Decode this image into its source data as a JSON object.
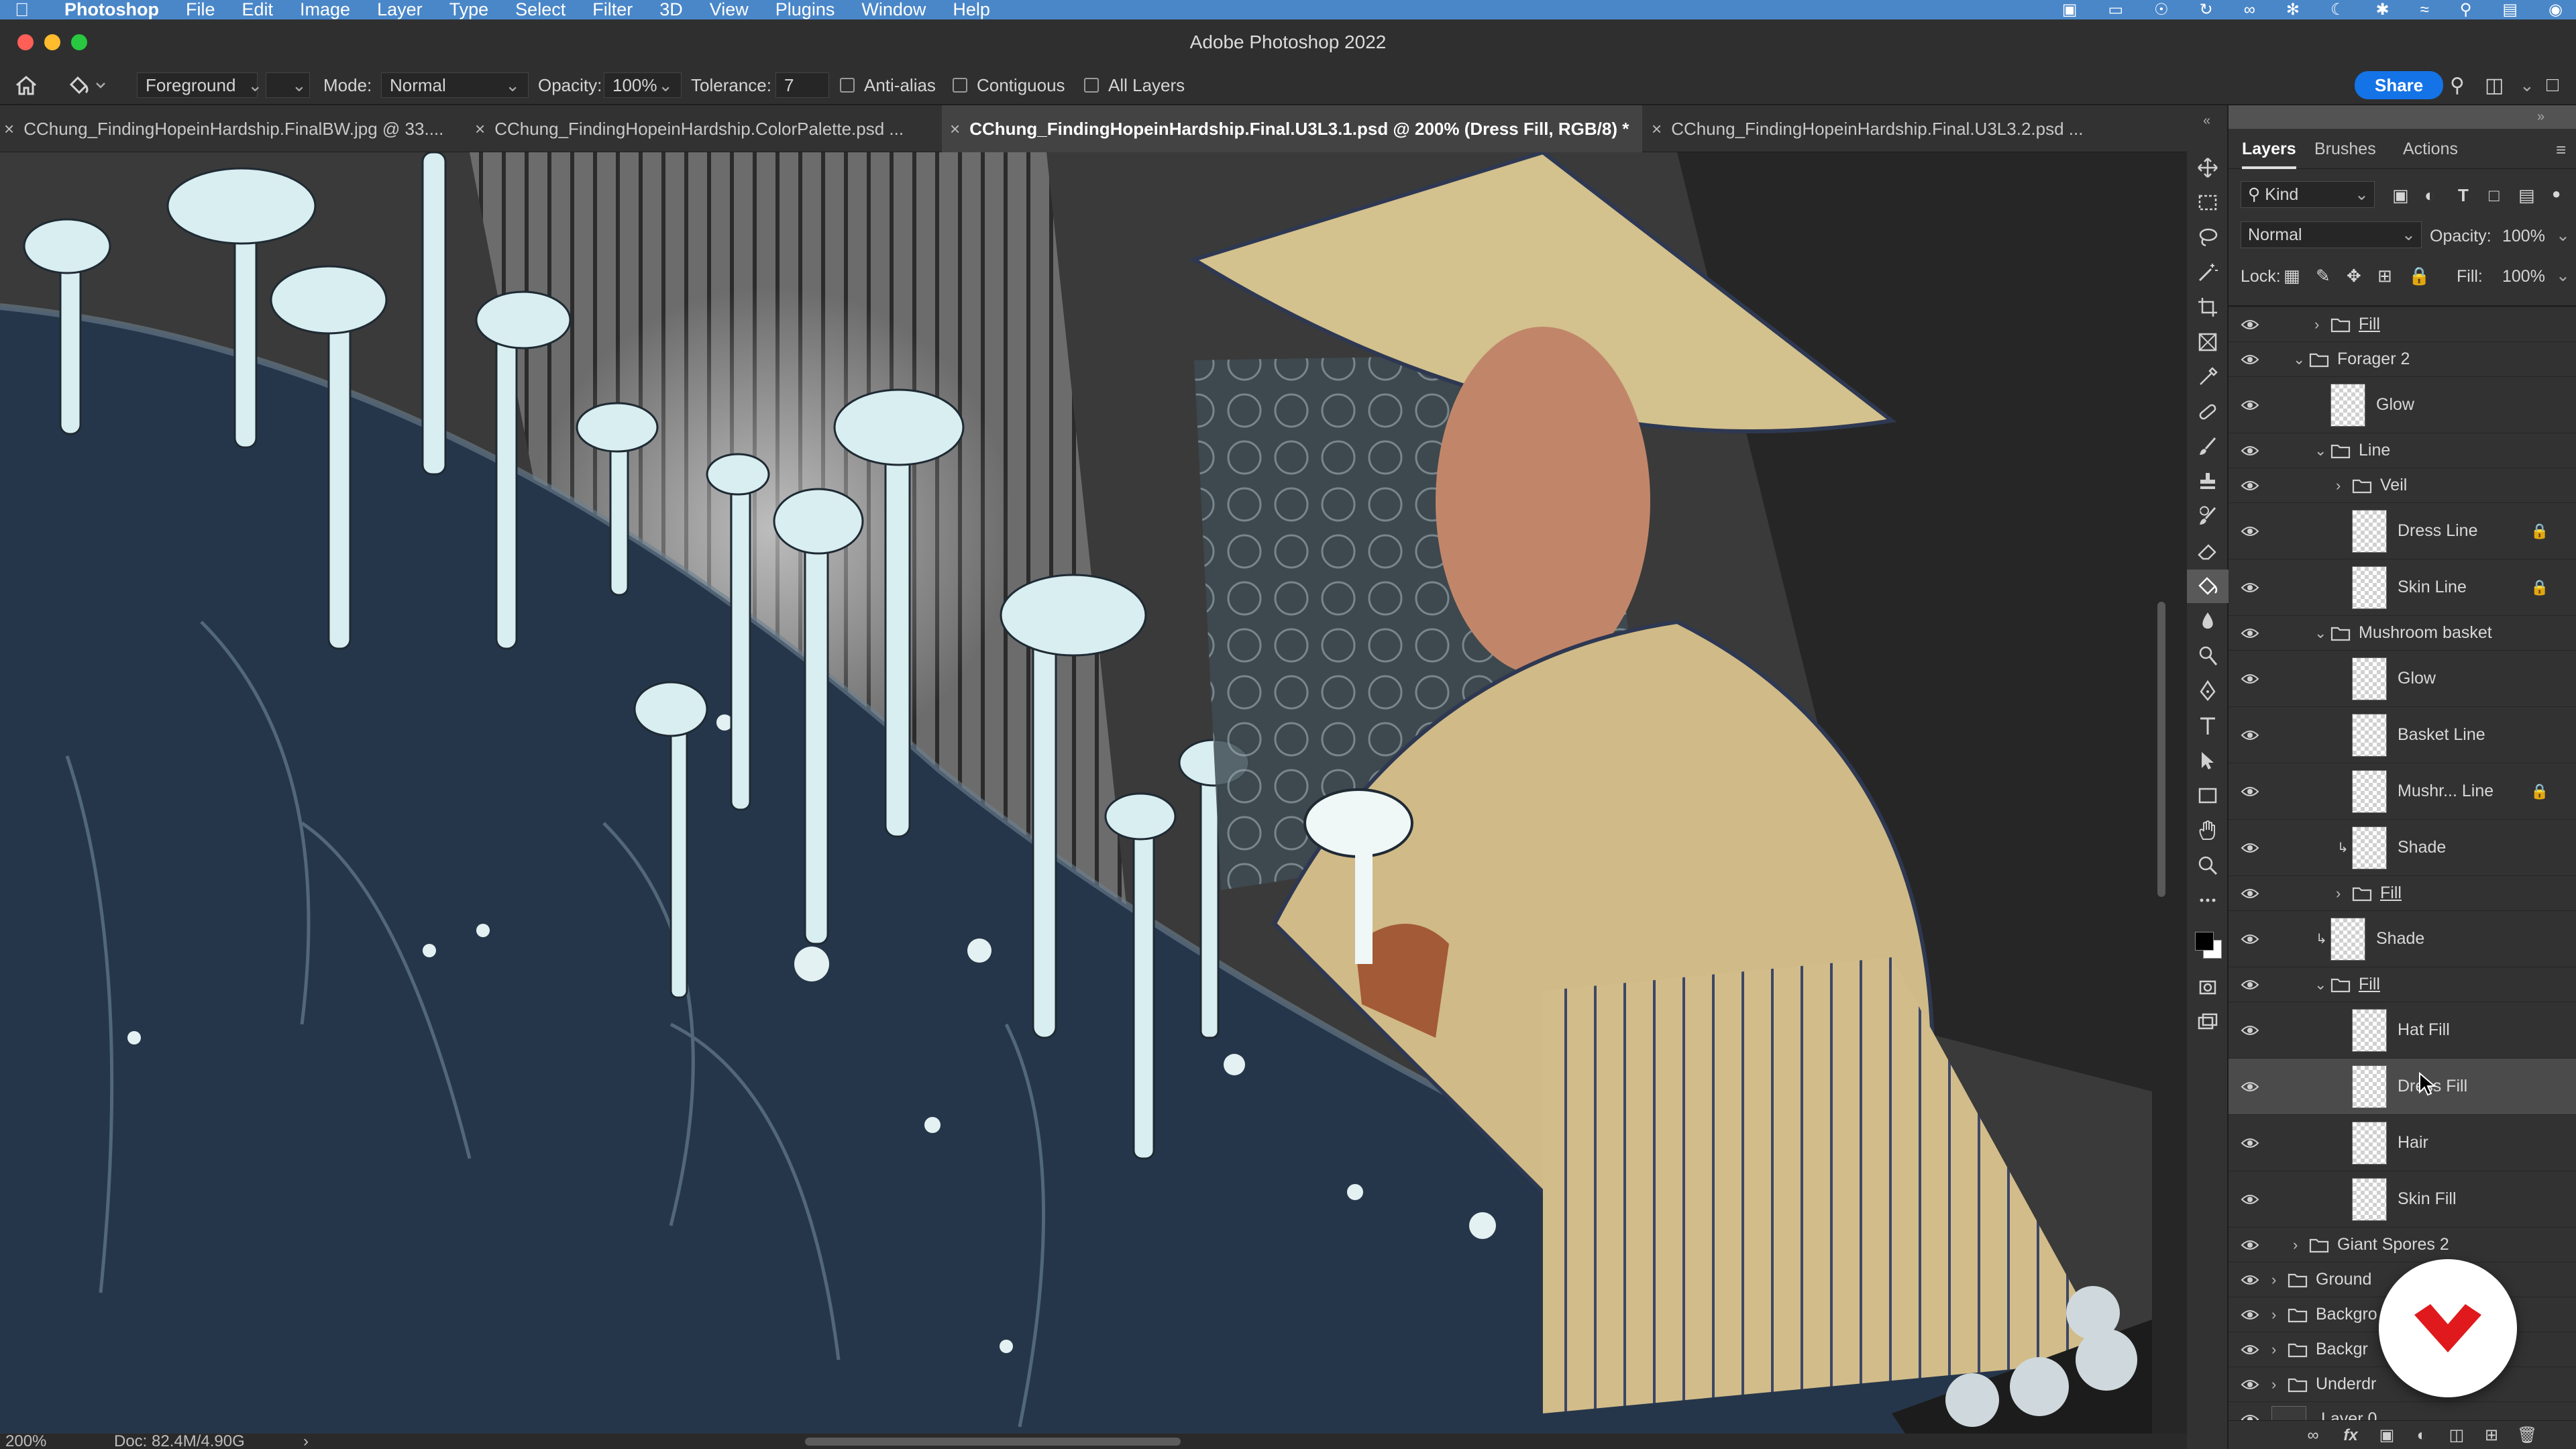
{
  "menubar": {
    "app_name": "Photoshop",
    "items": [
      "File",
      "Edit",
      "Image",
      "Layer",
      "Type",
      "Select",
      "Filter",
      "3D",
      "View",
      "Plugins",
      "Window",
      "Help"
    ]
  },
  "window": {
    "title": "Adobe Photoshop 2022"
  },
  "options": {
    "fill_source": "Foreground",
    "mode_label": "Mode:",
    "mode_value": "Normal",
    "opacity_label": "Opacity:",
    "opacity_value": "100%",
    "tolerance_label": "Tolerance:",
    "tolerance_value": "7",
    "anti_alias_label": "Anti-alias",
    "contiguous_label": "Contiguous",
    "all_layers_label": "All Layers",
    "share_label": "Share"
  },
  "tabs": [
    {
      "label": "CChung_FindingHopeinHardship.FinalBW.jpg @ 33....",
      "active": false
    },
    {
      "label": "CChung_FindingHopeinHardship.ColorPalette.psd ...",
      "active": false
    },
    {
      "label": "CChung_FindingHopeinHardship.Final.U3L3.1.psd @ 200% (Dress Fill, RGB/8) *",
      "active": true
    },
    {
      "label": "CChung_FindingHopeinHardship.Final.U3L3.2.psd ...",
      "active": false
    }
  ],
  "status": {
    "zoom": "200%",
    "doc": "Doc: 82.4M/4.90G",
    "arrow": "›"
  },
  "panel": {
    "tabs": [
      "Layers",
      "Brushes",
      "Actions"
    ],
    "active_tab": "Layers",
    "filter_kind": "Kind",
    "blend_mode": "Normal",
    "opacity_label": "Opacity:",
    "opacity_value": "100%",
    "lock_label": "Lock:",
    "fill_label": "Fill:",
    "fill_value": "100%"
  },
  "layers": [
    {
      "name": "Fill",
      "kind": "group",
      "indent": 2,
      "expanded": false,
      "underline": true
    },
    {
      "name": "Forager 2",
      "kind": "group",
      "indent": 1,
      "expanded": true
    },
    {
      "name": "Glow",
      "kind": "layer",
      "indent": 2
    },
    {
      "name": "Line",
      "kind": "group",
      "indent": 2,
      "expanded": true
    },
    {
      "name": "Veil",
      "kind": "group",
      "indent": 3,
      "expanded": false
    },
    {
      "name": "Dress Line",
      "kind": "layer",
      "indent": 3,
      "locked": true
    },
    {
      "name": "Skin Line",
      "kind": "layer",
      "indent": 3,
      "locked": true
    },
    {
      "name": "Mushroom basket",
      "kind": "group",
      "indent": 2,
      "expanded": true
    },
    {
      "name": "Glow",
      "kind": "layer",
      "indent": 3
    },
    {
      "name": "Basket Line",
      "kind": "layer",
      "indent": 3
    },
    {
      "name": "Mushr... Line",
      "kind": "layer",
      "indent": 3,
      "locked": true
    },
    {
      "name": "Shade",
      "kind": "layer",
      "indent": 3,
      "clipped": true
    },
    {
      "name": "Fill",
      "kind": "group",
      "indent": 3,
      "expanded": false,
      "underline": true
    },
    {
      "name": "Shade",
      "kind": "layer",
      "indent": 2,
      "clipped": true
    },
    {
      "name": "Fill",
      "kind": "group",
      "indent": 2,
      "expanded": true,
      "underline": true
    },
    {
      "name": "Hat Fill",
      "kind": "layer",
      "indent": 3
    },
    {
      "name": "Dress Fill",
      "kind": "layer",
      "indent": 3,
      "selected": true
    },
    {
      "name": "Hair",
      "kind": "layer",
      "indent": 3
    },
    {
      "name": "Skin Fill",
      "kind": "layer",
      "indent": 3
    },
    {
      "name": "Giant Spores 2",
      "kind": "group",
      "indent": 1,
      "expanded": false
    },
    {
      "name": "Ground",
      "kind": "group",
      "indent": 0,
      "expanded": false
    },
    {
      "name": "Backgro",
      "kind": "group",
      "indent": 0,
      "expanded": false
    },
    {
      "name": "Backgr",
      "kind": "group",
      "indent": 0,
      "expanded": false
    },
    {
      "name": "Underdr",
      "kind": "group",
      "indent": 0,
      "expanded": false
    },
    {
      "name": "Layer 0",
      "kind": "base",
      "indent": 0
    }
  ],
  "colors": {
    "accent": "#1473e6",
    "menubar": "#4a87c9",
    "panel_bg": "#323232",
    "selected_row": "#4b4b4b",
    "badge_red": "#e0191d"
  }
}
